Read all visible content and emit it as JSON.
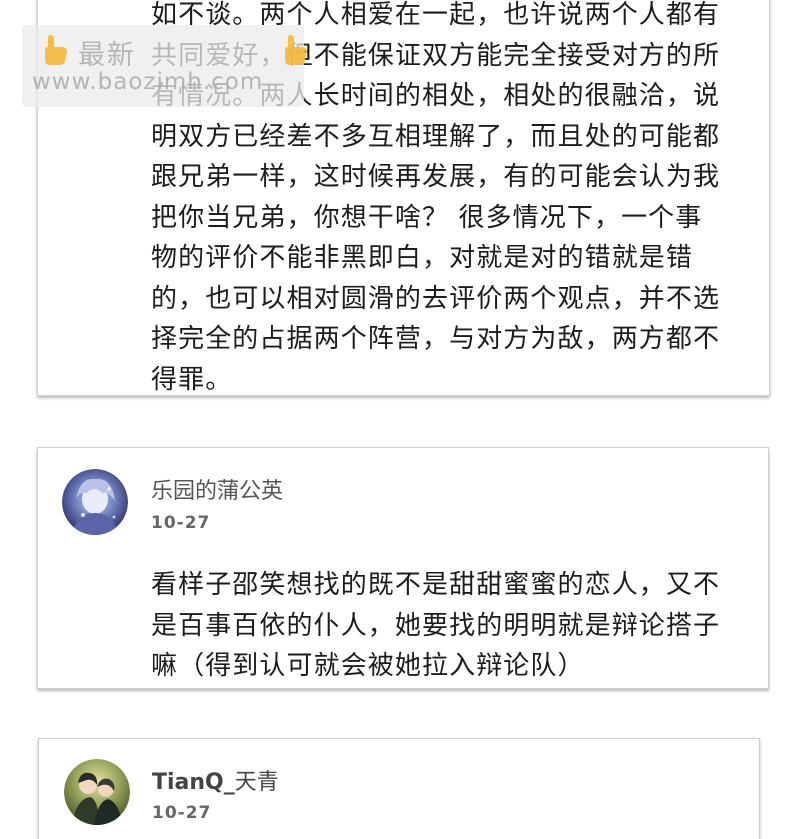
{
  "watermark": {
    "title": "最新",
    "url": "www.baozimh.com"
  },
  "comments": [
    {
      "text": "如不谈。两个人相爱在一起，也许说两个人都有\n共同爱好，但不能保证双方能完全接受对方的所\n有情况。两人长时间的相处，相处的很融洽，说\n明双方已经差不多互相理解了，而且处的可能都\n跟兄弟一样，这时候再发展，有的可能会认为我\n把你当兄弟，你想干啥？ 很多情况下，一个事\n物的评价不能非黑即白，对就是对的错就是错\n的，也可以相对圆滑的去评价两个观点，并不选\n择完全的占据两个阵营，与对方为敌，两方都不\n得罪。"
    },
    {
      "username": "乐园的蒲公英",
      "date": "10-27",
      "text": "看样子邵笑想找的既不是甜甜蜜蜜的恋人，又不\n是百事百依的仆人，她要找的明明就是辩论搭子\n嘛（得到认可就会被她拉入辩论队）"
    },
    {
      "username_latin": "TianQ_",
      "username_cjk": "天青",
      "date": "10-27"
    }
  ]
}
